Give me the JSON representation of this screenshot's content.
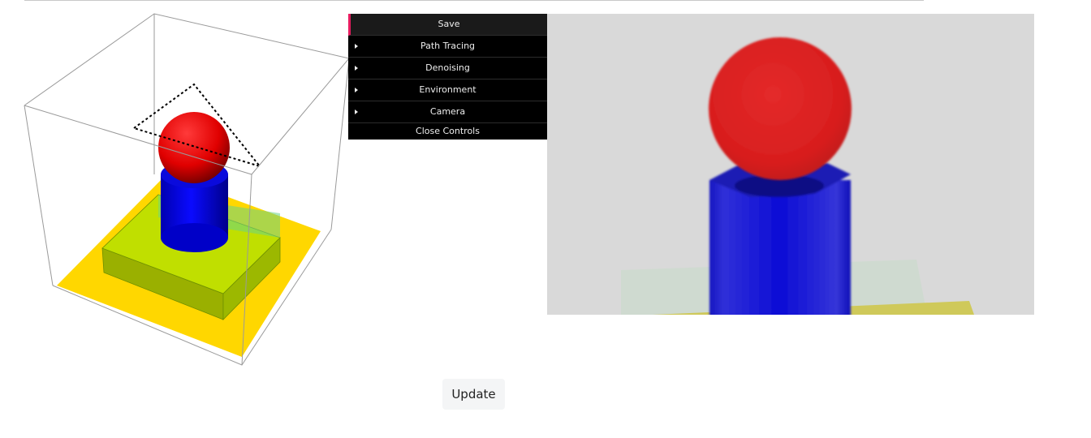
{
  "controls": {
    "save_label": "Save",
    "folders": [
      {
        "label": "Path Tracing"
      },
      {
        "label": "Denoising"
      },
      {
        "label": "Environment"
      },
      {
        "label": "Camera"
      }
    ],
    "close_label": "Close Controls"
  },
  "update_label": "Update",
  "colors": {
    "sphere": "#ff0000",
    "cylinder": "#0000ff",
    "box": "#7fd04a",
    "floor": "#ffd700",
    "render_background": "#d9d9d9",
    "panel_accent": "#e61d5f"
  }
}
